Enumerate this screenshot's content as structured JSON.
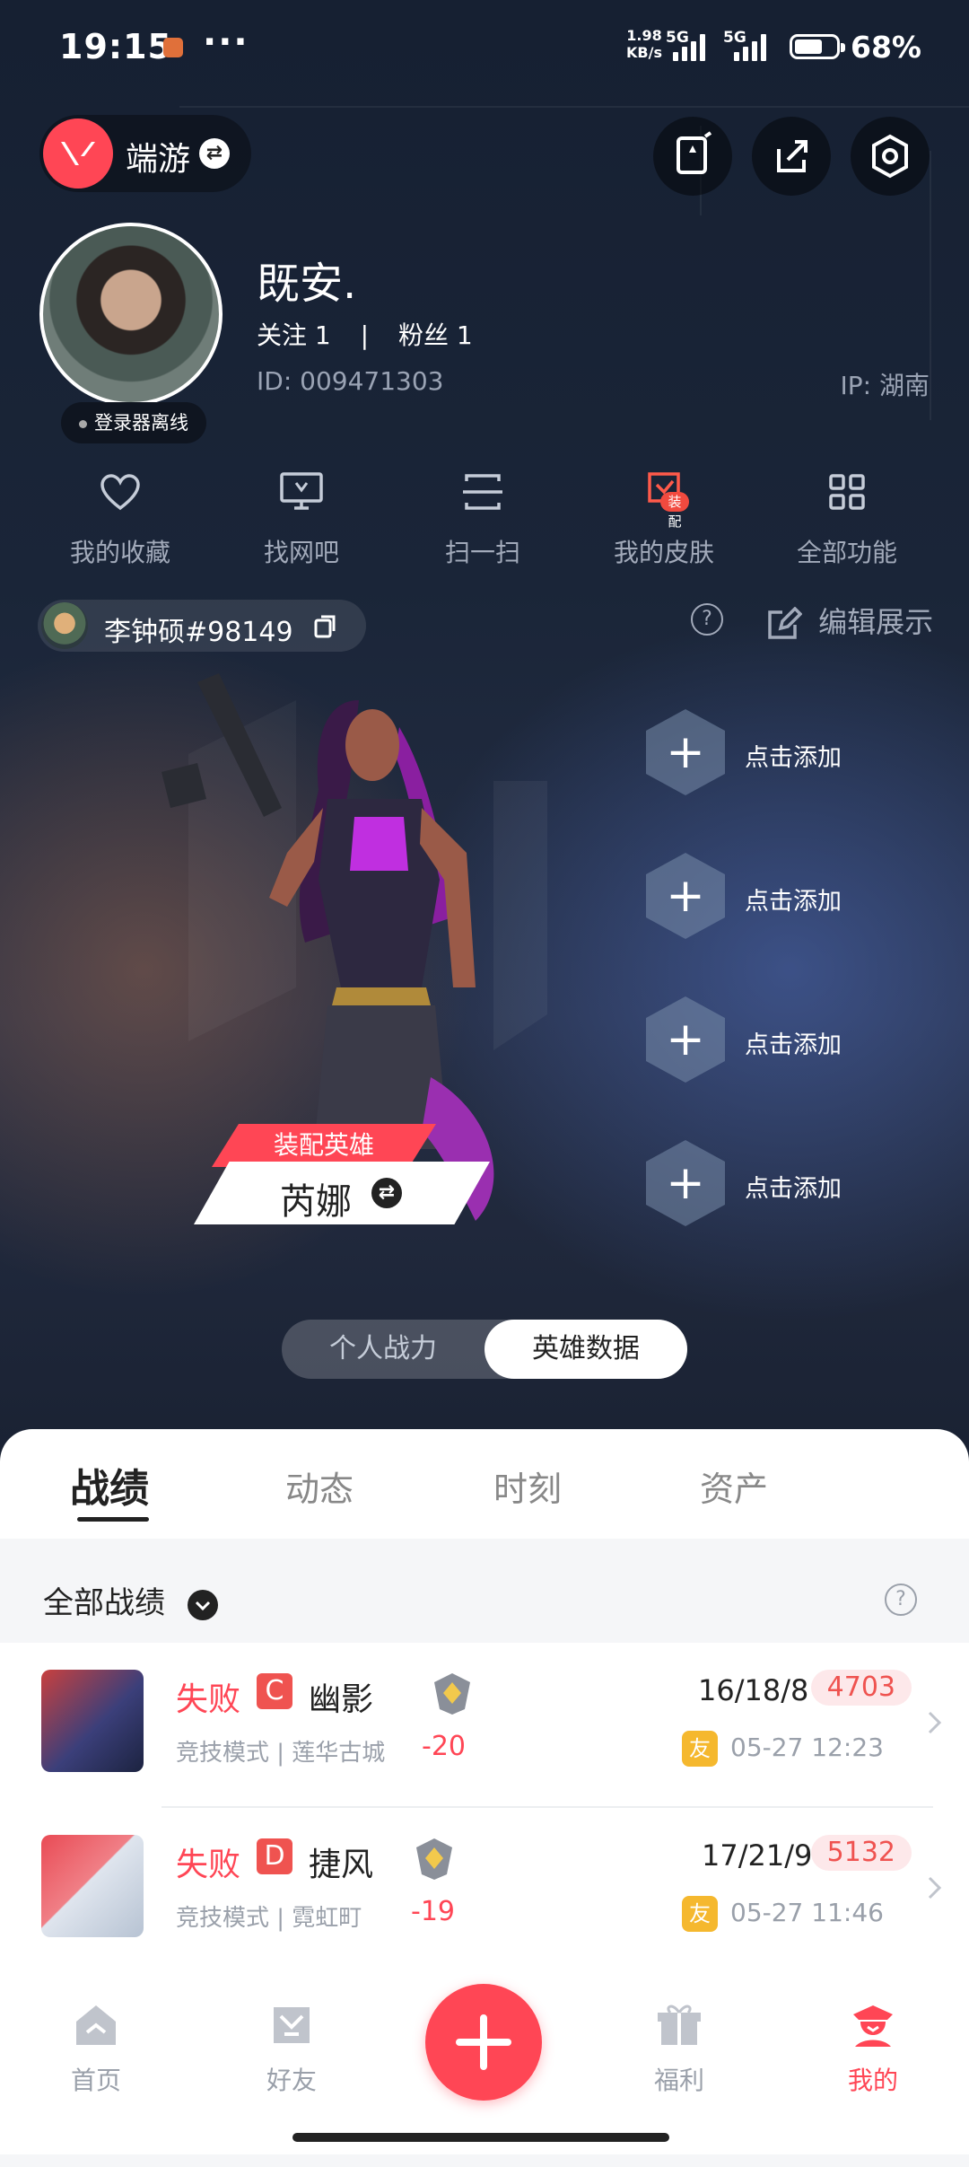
{
  "status_bar": {
    "time": "19:15",
    "speed_value": "1.98",
    "speed_unit": "KB/s",
    "network_1": "5G",
    "network_2": "5G",
    "battery_percent": "68%",
    "battery_level": 0.68
  },
  "header": {
    "game_name": "端游"
  },
  "profile": {
    "nickname": "既安.",
    "follow_label": "关注",
    "follow_count": "1",
    "divider": "|",
    "fans_label": "粉丝",
    "fans_count": "1",
    "id_text": "ID: 009471303",
    "ip_text": "IP: 湖南",
    "online_status": "登录器离线"
  },
  "quick_actions": [
    {
      "label": "我的收藏",
      "icon": "heart-icon"
    },
    {
      "label": "找网吧",
      "icon": "monitor-icon"
    },
    {
      "label": "扫一扫",
      "icon": "scan-icon"
    },
    {
      "label": "我的皮肤",
      "icon": "skin-icon",
      "badge": "装配"
    },
    {
      "label": "全部功能",
      "icon": "grid-icon"
    }
  ],
  "riot_account": {
    "name": "李钟硕#98149",
    "edit_label": "编辑展示"
  },
  "showcase": {
    "add_slot_label": "点击添加",
    "slots": [
      "点击添加",
      "点击添加",
      "点击添加",
      "点击添加"
    ],
    "equip_tag": "装配英雄",
    "agent_name": "芮娜"
  },
  "segment": {
    "options": [
      "个人战力",
      "英雄数据"
    ],
    "selected": "英雄数据"
  },
  "tabs": [
    {
      "label": "战绩",
      "active": true
    },
    {
      "label": "动态",
      "active": false
    },
    {
      "label": "时刻",
      "active": false
    },
    {
      "label": "资产",
      "active": false
    }
  ],
  "match_filter": "全部战绩",
  "matches": [
    {
      "result": "失败",
      "grade": "C",
      "agent": "幽影",
      "mode": "竞技模式 | 莲华古城",
      "rank_delta": "-20",
      "kda": "16/18/8",
      "score": "4703",
      "friend_badge": "友",
      "date": "05-27 12:23"
    },
    {
      "result": "失败",
      "grade": "D",
      "agent": "捷风",
      "mode": "竞技模式 | 霓虹町",
      "rank_delta": "-19",
      "kda": "17/21/9",
      "score": "5132",
      "friend_badge": "友",
      "date": "05-27 11:46"
    }
  ],
  "bottom_nav": [
    {
      "label": "首页",
      "icon": "home-icon",
      "active": false
    },
    {
      "label": "好友",
      "icon": "friends-icon",
      "active": false
    },
    {
      "label": "",
      "icon": "plus-icon",
      "active": false
    },
    {
      "label": "福利",
      "icon": "gift-icon",
      "active": false
    },
    {
      "label": "我的",
      "icon": "profile-icon",
      "active": true
    }
  ],
  "colors": {
    "accent": "#ff4655",
    "background": "#131c2c",
    "friend_badge": "#f5b82e"
  }
}
